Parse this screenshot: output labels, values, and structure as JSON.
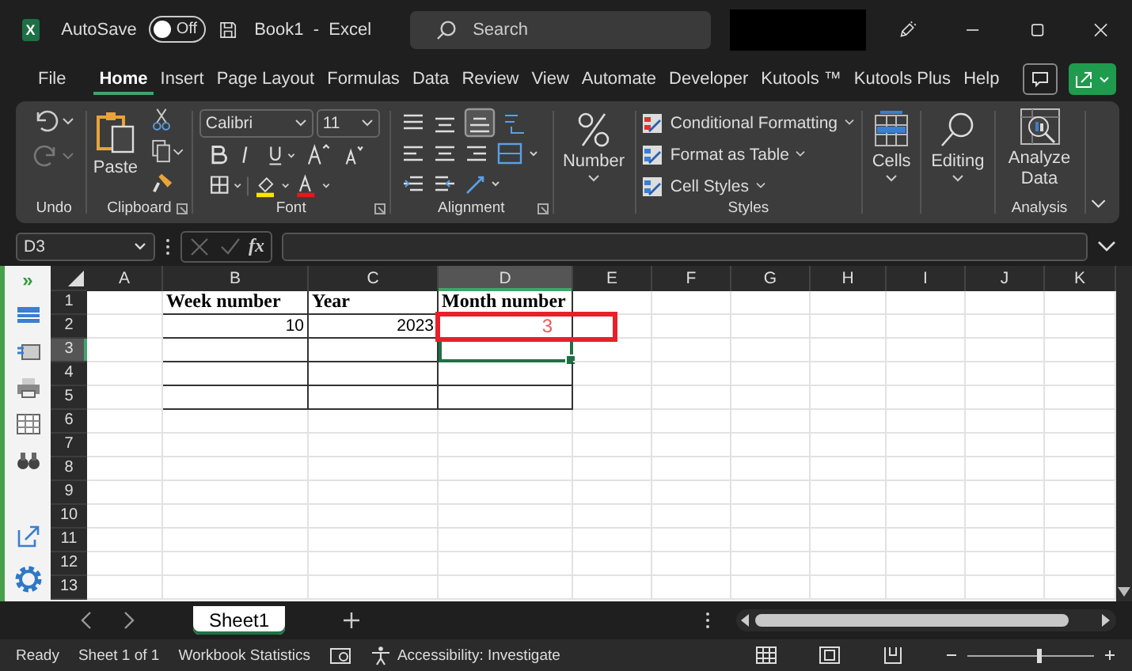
{
  "title_bar": {
    "app_letter": "X",
    "autosave_label": "AutoSave",
    "autosave": {
      "on": false,
      "label": "Off"
    },
    "document_title": "Book1  -  Excel",
    "search": {
      "placeholder": "Search"
    }
  },
  "menu_tabs": [
    {
      "label": "File",
      "selected": false
    },
    {
      "label": "Home",
      "selected": true
    },
    {
      "label": "Insert",
      "selected": false
    },
    {
      "label": "Page Layout",
      "selected": false
    },
    {
      "label": "Formulas",
      "selected": false
    },
    {
      "label": "Data",
      "selected": false
    },
    {
      "label": "Review",
      "selected": false
    },
    {
      "label": "View",
      "selected": false
    },
    {
      "label": "Automate",
      "selected": false
    },
    {
      "label": "Developer",
      "selected": false
    },
    {
      "label": "Kutools ™",
      "selected": false
    },
    {
      "label": "Kutools Plus",
      "selected": false
    },
    {
      "label": "Help",
      "selected": false
    }
  ],
  "ribbon": {
    "undo": {
      "label": "Undo"
    },
    "clipboard": {
      "paste": "Paste",
      "label": "Clipboard"
    },
    "font": {
      "name": "Calibri",
      "size": "11",
      "label": "Font"
    },
    "alignment": {
      "label": "Alignment"
    },
    "number": {
      "button": "Number"
    },
    "styles": {
      "items": [
        "Conditional Formatting",
        "Format as Table",
        "Cell Styles"
      ],
      "label": "Styles"
    },
    "cells": {
      "button": "Cells"
    },
    "editing": {
      "button": "Editing"
    },
    "analysis": {
      "button": "Analyze Data",
      "label": "Analysis"
    }
  },
  "formula_bar": {
    "name_box": "D3",
    "function_button": "fx"
  },
  "side_panel": {
    "expand_glyph": "»"
  },
  "grid": {
    "columns": [
      {
        "letter": "A",
        "selected": false,
        "in_table": false
      },
      {
        "letter": "B",
        "selected": false,
        "in_table": true
      },
      {
        "letter": "C",
        "selected": false,
        "in_table": true
      },
      {
        "letter": "D",
        "selected": true,
        "in_table": true
      },
      {
        "letter": "E",
        "selected": false,
        "in_table": false
      },
      {
        "letter": "F",
        "selected": false,
        "in_table": false
      },
      {
        "letter": "G",
        "selected": false,
        "in_table": false
      },
      {
        "letter": "H",
        "selected": false,
        "in_table": false
      },
      {
        "letter": "I",
        "selected": false,
        "in_table": false
      },
      {
        "letter": "J",
        "selected": false,
        "in_table": false
      },
      {
        "letter": "K",
        "selected": false,
        "in_table": false
      }
    ],
    "rows": [
      {
        "number": "1",
        "selected": false,
        "in_table": true,
        "cells": [
          {
            "text": "Week number",
            "kind": "heading",
            "annotated": false
          },
          {
            "text": "Year",
            "kind": "heading",
            "annotated": false
          },
          {
            "text": "Month number",
            "kind": "heading",
            "annotated": false
          }
        ]
      },
      {
        "number": "2",
        "selected": false,
        "in_table": true,
        "cells": [
          {
            "text": "10",
            "kind": "number",
            "annotated": false
          },
          {
            "text": "2023",
            "kind": "number",
            "annotated": false
          },
          {
            "text": "3",
            "kind": "result",
            "annotated": true
          }
        ]
      },
      {
        "number": "3",
        "selected": true,
        "in_table": true
      },
      {
        "number": "4",
        "selected": false,
        "in_table": true
      },
      {
        "number": "5",
        "selected": false,
        "in_table": true
      },
      {
        "number": "6",
        "selected": false,
        "in_table": false
      },
      {
        "number": "7",
        "selected": false,
        "in_table": false
      },
      {
        "number": "8",
        "selected": false,
        "in_table": false
      },
      {
        "number": "9",
        "selected": false,
        "in_table": false
      },
      {
        "number": "10",
        "selected": false,
        "in_table": false
      },
      {
        "number": "11",
        "selected": false,
        "in_table": false
      },
      {
        "number": "12",
        "selected": false,
        "in_table": false
      },
      {
        "number": "13",
        "selected": false,
        "in_table": false
      }
    ]
  },
  "sheet_tabs": [
    {
      "label": "Sheet1",
      "selected": true
    }
  ],
  "status_bar": {
    "ready": "Ready",
    "sheet_count": "Sheet 1 of 1",
    "statistics": "Workbook Statistics",
    "accessibility": "Accessibility: Investigate",
    "zoom": {
      "level": 0.55
    }
  }
}
